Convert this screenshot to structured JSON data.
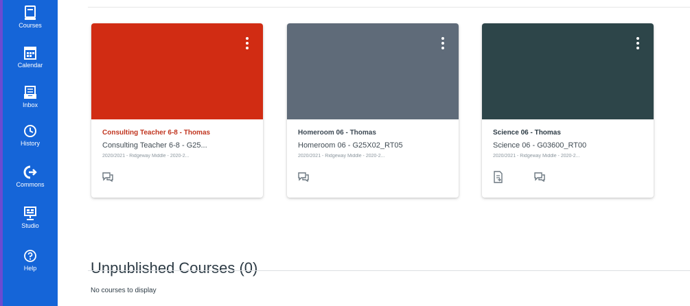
{
  "nav": {
    "items": [
      {
        "label": "Courses",
        "icon": "book-icon"
      },
      {
        "label": "Calendar",
        "icon": "calendar-icon"
      },
      {
        "label": "Inbox",
        "icon": "inbox-icon"
      },
      {
        "label": "History",
        "icon": "clock-icon"
      },
      {
        "label": "Commons",
        "icon": "commons-icon"
      },
      {
        "label": "Studio",
        "icon": "studio-icon"
      },
      {
        "label": "Help",
        "icon": "question-icon"
      }
    ],
    "color": "#1565d8",
    "edge_color": "#6b4bd1"
  },
  "cards": [
    {
      "title": "Consulting Teacher 6-8 - Thomas",
      "subtitle": "Consulting Teacher 6-8 - G25...",
      "term": "2020/2021 - Ridgeway Middle - 2020-2...",
      "hero_color": "#d12c13",
      "title_color": "#c0351f"
    },
    {
      "title": "Homeroom 06 - Thomas",
      "subtitle": "Homeroom 06 - G25X02_RT05",
      "term": "2020/2021 - Ridgeway Middle - 2020-2...",
      "hero_color": "#5f6b79",
      "title_color": "#3c4853"
    },
    {
      "title": "Science 06 - Thomas",
      "subtitle": "Science 06 - G03600_RT00",
      "term": "2020/2021 - Ridgeway Middle - 2020-2...",
      "hero_color": "#2d4549",
      "title_color": "#2d3b45"
    }
  ],
  "unpublished": {
    "heading": "Unpublished Courses (0)",
    "empty_message": "No courses to display"
  }
}
